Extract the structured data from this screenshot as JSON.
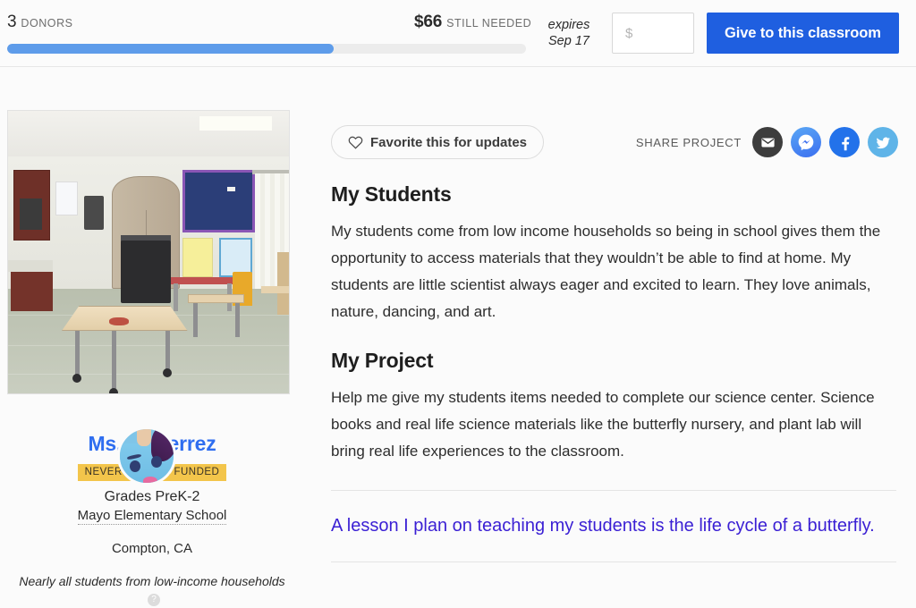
{
  "header": {
    "donors_count": "3",
    "donors_label": "DONORS",
    "amount_needed": "$66",
    "needed_label": "STILL NEEDED",
    "progress_percent": 63,
    "expires_label": "expires",
    "expires_date": "Sep 17",
    "amount_placeholder": "$",
    "amount_value": "",
    "give_button": "Give to this classroom"
  },
  "left": {
    "favorite_button": "Favorite this for updates",
    "teacher_name": "Ms. Gutierrez",
    "badge": "NEVER BEFORE FUNDED",
    "grades": "Grades PreK-2",
    "school": "Mayo Elementary School",
    "city": "Compton, CA",
    "poverty_note": "Nearly all students from low-income households",
    "help_glyph": "?"
  },
  "share": {
    "label": "SHARE PROJECT",
    "items": [
      {
        "name": "email",
        "glyph": "✉"
      },
      {
        "name": "messenger",
        "glyph": "⚡"
      },
      {
        "name": "facebook",
        "glyph": "f"
      },
      {
        "name": "twitter",
        "glyph": "🐦"
      }
    ]
  },
  "main": {
    "students_heading": "My Students",
    "students_body": "My students come from low income households so being in school gives them the opportunity to access materials that they wouldn’t be able to find at home. My students are little scientist always eager and excited to learn. They love animals, nature, dancing, and art.",
    "project_heading": "My Project",
    "project_body": "Help me give my students items needed to complete our science center. Science books and real life science materials like the butterfly nursery, and plant lab will bring real life experiences to the classroom.",
    "lesson_highlight": "A lesson I plan on teaching my students is the life cycle of a butterfly."
  },
  "colors": {
    "accent_blue": "#1f5fe0",
    "progress_blue": "#5e9cea",
    "teacher_link": "#2f6ef0",
    "badge_yellow": "#f3c54b",
    "lesson_violet": "#3a1fd4"
  }
}
